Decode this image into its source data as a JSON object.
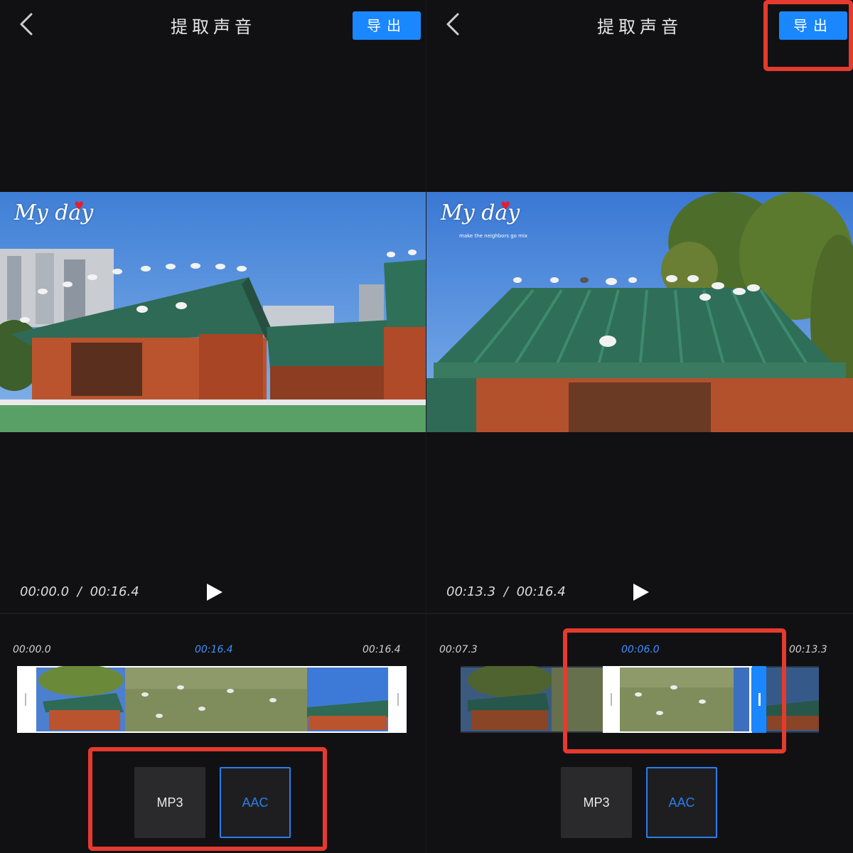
{
  "panels": [
    {
      "title": "提取声音",
      "export_label": "导出",
      "watermark": "My day",
      "watermark_sub": "",
      "time_current": "00:00.0",
      "time_sep": "/",
      "time_total": "00:16.4",
      "timeline": {
        "left": "00:00.0",
        "mid": "00:16.4",
        "right": "00:16.4"
      },
      "formats": [
        "MP3",
        "AAC"
      ],
      "selected_format": "AAC",
      "highlight": "format-buttons"
    },
    {
      "title": "提取声音",
      "export_label": "导出",
      "watermark": "My day",
      "watermark_sub": "make the neighbors go mix",
      "time_current": "00:13.3",
      "time_sep": "/",
      "time_total": "00:16.4",
      "timeline": {
        "left": "00:07.3",
        "mid": "00:06.0",
        "right": "00:13.3"
      },
      "formats": [
        "MP3",
        "AAC"
      ],
      "selected_format": "AAC",
      "highlight": "export-button and trim-selection"
    }
  ],
  "colors": {
    "background": "#111113",
    "accent": "#1a87ff",
    "highlight": "#e53a2e",
    "selected_format": "#2b7de9"
  },
  "icons": [
    "chevron-left-icon",
    "play-icon",
    "location-pin-icon",
    "heart-icon"
  ]
}
